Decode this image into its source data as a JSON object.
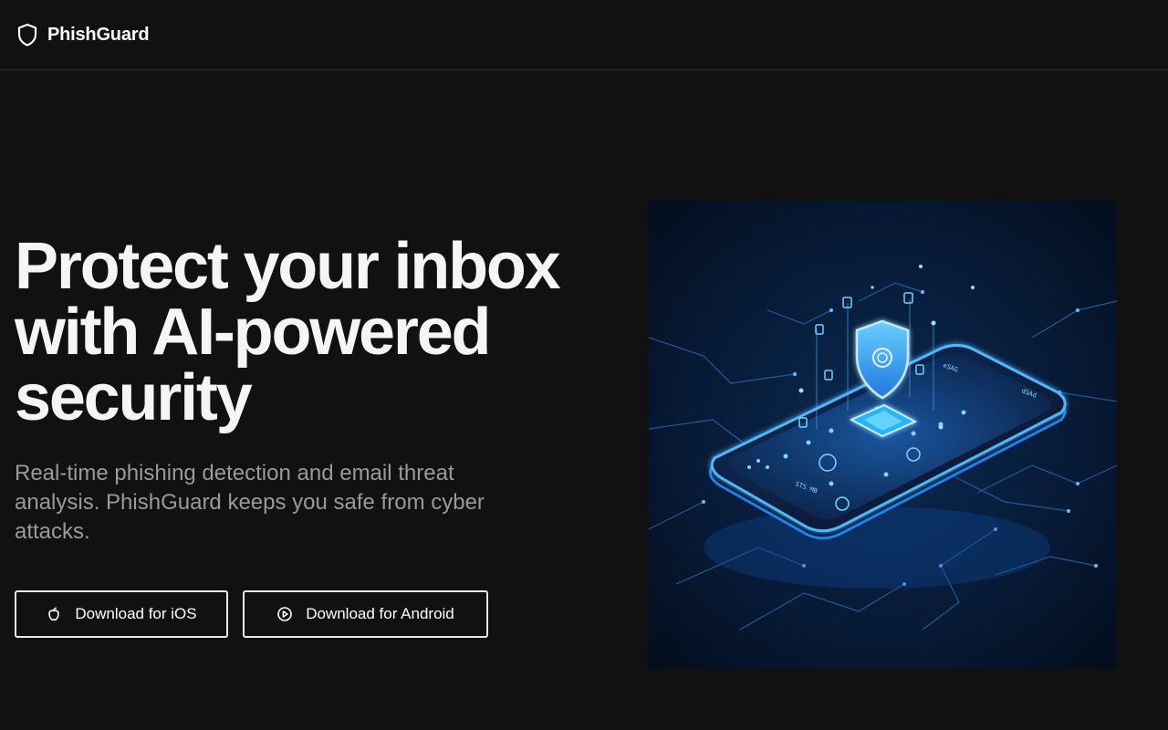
{
  "header": {
    "brand_name": "PhishGuard",
    "brand_icon": "shield-icon"
  },
  "hero": {
    "title": "Protect your inbox with AI-powered security",
    "subtitle": "Real-time phishing detection and email threat analysis. PhishGuard keeps you safe from cyber attacks.",
    "buttons": [
      {
        "label": "Download for iOS",
        "icon": "apple-icon"
      },
      {
        "label": "Download for Android",
        "icon": "play-icon"
      }
    ],
    "illustration": {
      "phone_labels": [
        "STS MB",
        "eSAG",
        "dSAd"
      ]
    }
  },
  "colors": {
    "background": "#111111",
    "text": "#ffffff",
    "muted_text": "#9a9a9a",
    "accent": "#2fa8ff"
  }
}
